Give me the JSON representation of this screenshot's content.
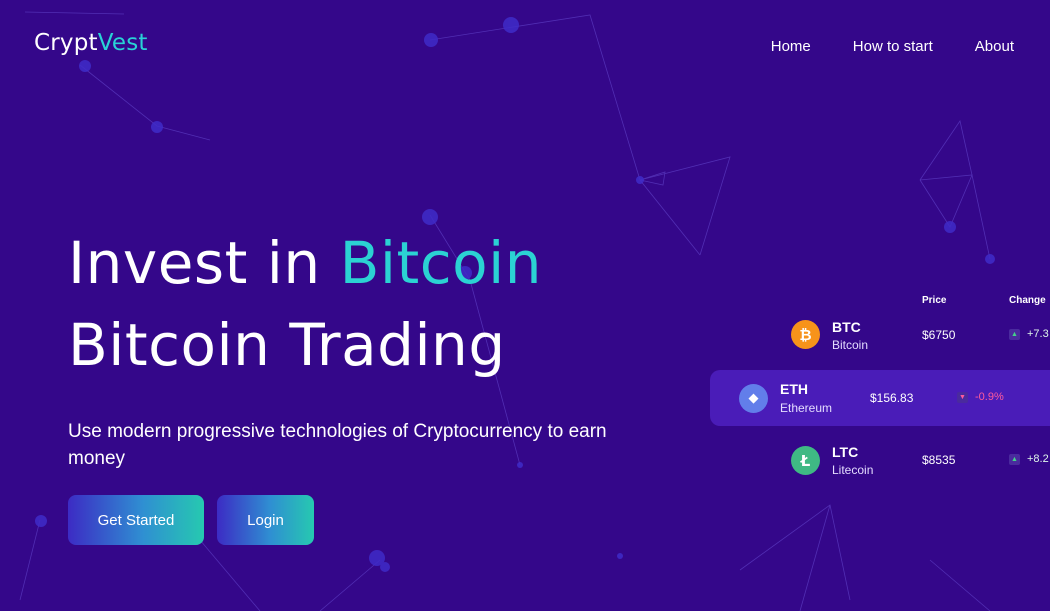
{
  "brand": {
    "part1": "Crypt",
    "part2": "Vest",
    "accent_color": "#29d3d6"
  },
  "nav": {
    "items": [
      "Home",
      "How to start",
      "About"
    ]
  },
  "hero": {
    "line1_prefix": "Invest in ",
    "line1_highlight": "Bitcoin",
    "line2": "Bitcoin Trading",
    "subtitle": "Use modern progressive technologies of Cryptocurrency to earn money"
  },
  "buttons": {
    "get_started": "Get Started",
    "login": "Login"
  },
  "table": {
    "price_header": "Price",
    "change_header": "Change",
    "rows": [
      {
        "symbol": "BTC",
        "name": "Bitcoin",
        "price": "$6750",
        "change": "+7.3",
        "direction": "up",
        "icon": "bitcoin-icon",
        "icon_glyph": "₿",
        "icon_color": "#f7931a"
      },
      {
        "symbol": "ETH",
        "name": "Ethereum",
        "price": "$156.83",
        "change": "-0.9%",
        "direction": "down",
        "icon": "ethereum-icon",
        "icon_glyph": "◆",
        "icon_color": "#627eea"
      },
      {
        "symbol": "LTC",
        "name": "Litecoin",
        "price": "$8535",
        "change": "+8.2",
        "direction": "up",
        "icon": "litecoin-icon",
        "icon_glyph": "Ł",
        "icon_color": "#3fb984"
      }
    ]
  },
  "colors": {
    "background": "#34078a",
    "highlight_row": "#4a1cb8",
    "positive": "#44d38a",
    "negative": "#ff5a9d"
  }
}
